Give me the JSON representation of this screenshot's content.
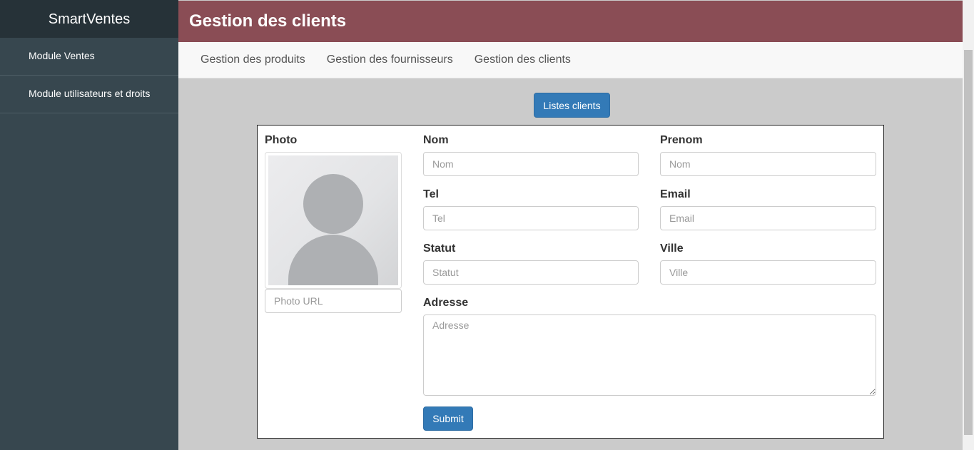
{
  "sidebar": {
    "brand": "SmartVentes",
    "items": [
      {
        "label": "Module Ventes"
      },
      {
        "label": "Module utilisateurs et droits"
      }
    ]
  },
  "header": {
    "title": "Gestion des clients"
  },
  "nav": {
    "links": [
      {
        "label": "Gestion des produits"
      },
      {
        "label": "Gestion des fournisseurs"
      },
      {
        "label": "Gestion des clients"
      }
    ]
  },
  "actions": {
    "list_clients_label": "Listes clients"
  },
  "form": {
    "photo_label": "Photo",
    "photo_url_placeholder": "Photo URL",
    "nom_label": "Nom",
    "nom_placeholder": "Nom",
    "prenom_label": "Prenom",
    "prenom_placeholder": "Nom",
    "tel_label": "Tel",
    "tel_placeholder": "Tel",
    "email_label": "Email",
    "email_placeholder": "Email",
    "statut_label": "Statut",
    "statut_placeholder": "Statut",
    "ville_label": "Ville",
    "ville_placeholder": "Ville",
    "adresse_label": "Adresse",
    "adresse_placeholder": "Adresse",
    "submit_label": "Submit"
  },
  "colors": {
    "sidebar": "#37474f",
    "brand_bar": "#263238",
    "header": "#8a4d55",
    "primary_button": "#337ab7",
    "content_background": "#cbcbcb"
  }
}
